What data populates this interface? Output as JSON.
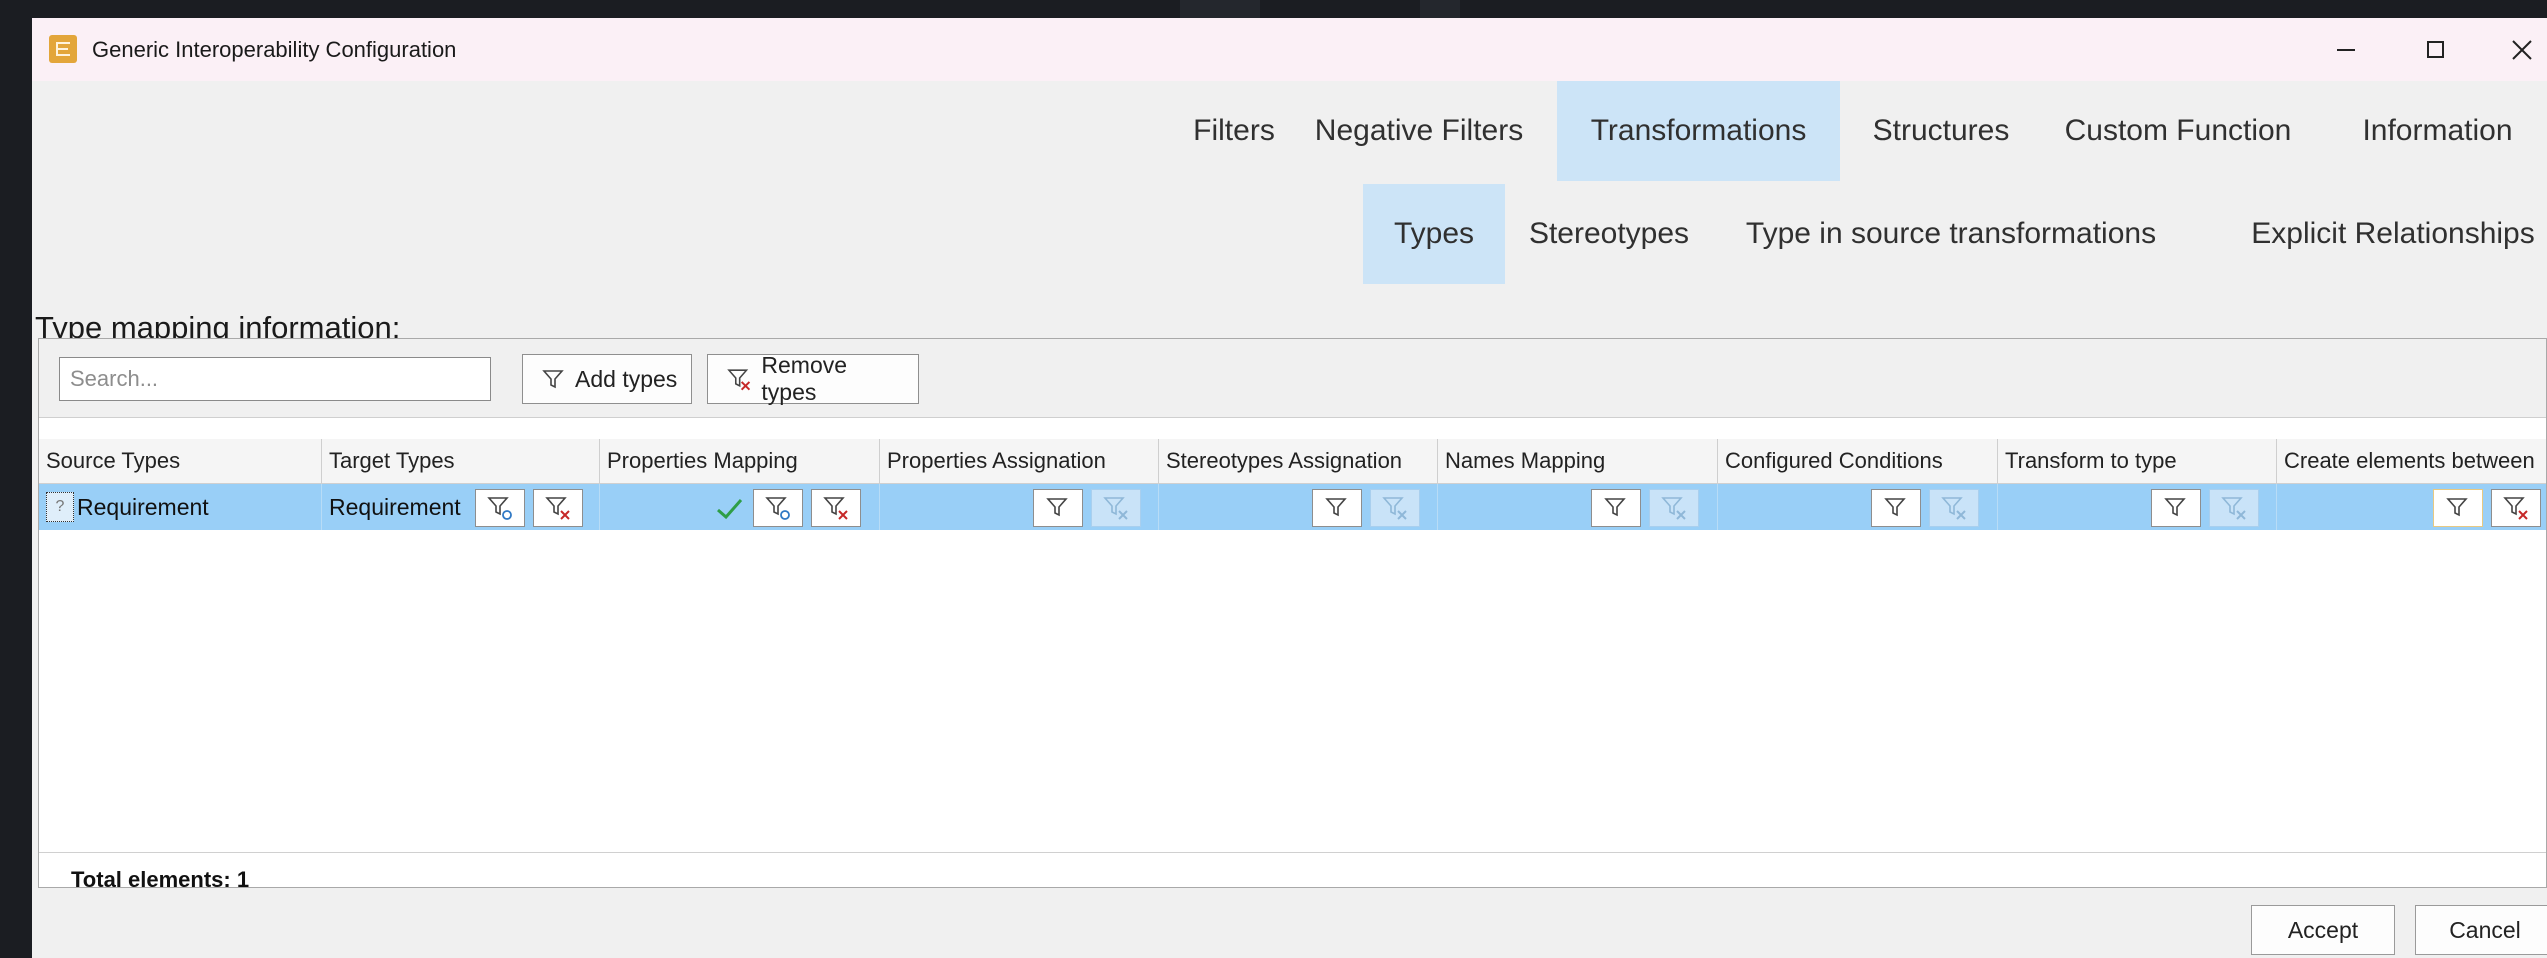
{
  "window": {
    "title": "Generic Interoperability Configuration",
    "controls": {
      "minimize": "—",
      "maximize": "",
      "close": "✕"
    }
  },
  "main_tabs": [
    "Filters",
    "Negative Filters",
    "Transformations",
    "Structures",
    "Custom Function",
    "Information"
  ],
  "main_tabs_active": "Transformations",
  "sub_tabs": [
    "Types",
    "Stereotypes",
    "Type in source transformations",
    "Explicit Relationships"
  ],
  "sub_tabs_active": "Types",
  "section_label": "Type mapping information:",
  "search": {
    "placeholder": "Search...",
    "value": ""
  },
  "toolbar": {
    "add_label": "Add types",
    "remove_label": "Remove types"
  },
  "columns": [
    "Source Types",
    "Target Types",
    "Properties Mapping",
    "Properties Assignation",
    "Stereotypes Assignation",
    "Names Mapping",
    "Configured Conditions",
    "Transform to type",
    "Create elements between"
  ],
  "rows": [
    {
      "source": "Requirement",
      "target": "Requirement",
      "properties_mapping_configured": true
    }
  ],
  "footer": {
    "total": "Total elements: 1"
  },
  "dialog_buttons": {
    "accept": "Accept",
    "cancel": "Cancel"
  },
  "colors": {
    "accent_selected": "#99cff7",
    "tab_active": "#cce4f7",
    "check": "#2e9e47",
    "remove_red": "#c62828"
  }
}
